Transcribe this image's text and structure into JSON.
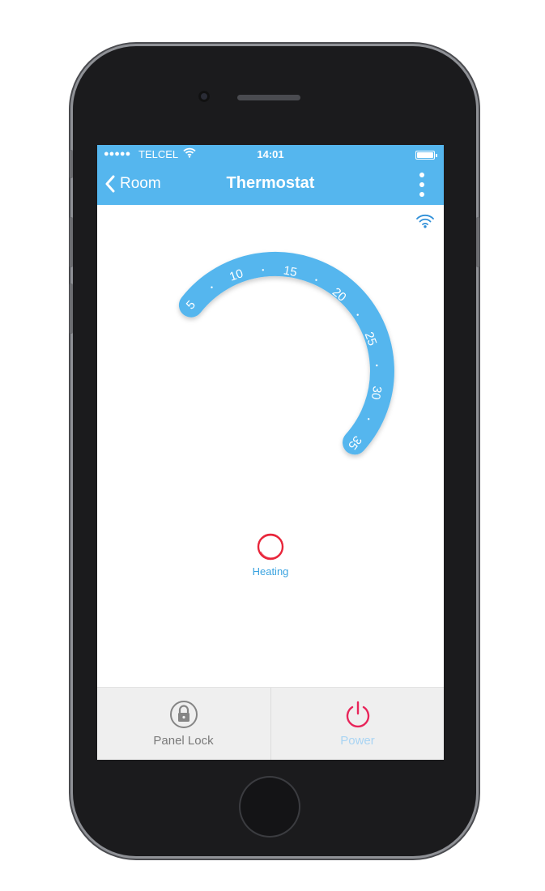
{
  "status_bar": {
    "signal": "●●●●●",
    "carrier": "TELCEL",
    "time": "14:01"
  },
  "nav": {
    "back_label": "Room",
    "title": "Thermostat"
  },
  "dial": {
    "min": 5,
    "max": 35,
    "tick_labels": [
      "5",
      "10",
      "15",
      "20",
      "25",
      "30",
      "35"
    ],
    "color": "#55b6ee"
  },
  "mode": {
    "label": "Heating",
    "icon": "heating-ring-icon",
    "icon_color": "#e8253a"
  },
  "bottom_bar": {
    "panel_lock_label": "Panel Lock",
    "panel_lock_icon": "lock-icon",
    "power_label": "Power",
    "power_icon": "power-icon",
    "power_color": "#e8255a"
  },
  "colors": {
    "accent": "#55b6ee",
    "heating": "#e8253a"
  }
}
